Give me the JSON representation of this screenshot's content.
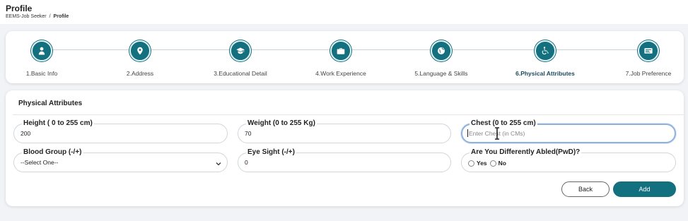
{
  "header": {
    "title": "Profile",
    "breadcrumb": [
      "EEMS-Job Seeker",
      "Profile"
    ],
    "separator": "/"
  },
  "stepper": {
    "steps": [
      {
        "label": "1.Basic Info",
        "icon": "user-icon",
        "active": false
      },
      {
        "label": "2.Address",
        "icon": "location-pin-icon",
        "active": false
      },
      {
        "label": "3.Educational Detail",
        "icon": "graduation-cap-icon",
        "active": false
      },
      {
        "label": "4.Work Experience",
        "icon": "briefcase-icon",
        "active": false
      },
      {
        "label": "5.Language & Skills",
        "icon": "globe-icon",
        "active": false
      },
      {
        "label": "6.Physical Attributes",
        "icon": "wheelchair-icon",
        "active": true
      },
      {
        "label": "7.Job Preference",
        "icon": "id-card-icon",
        "active": false
      }
    ]
  },
  "form": {
    "section_title": "Physical Attributes",
    "height": {
      "label": "Height ( 0 to 255 cm)",
      "value": "200"
    },
    "weight": {
      "label": "Weight (0 to 255 Kg)",
      "value": "70"
    },
    "chest": {
      "label": "Chest (0 to 255 cm)",
      "value": "",
      "placeholder": "Enter Chest (in CMs)"
    },
    "blood_group": {
      "label": "Blood Group (-/+)",
      "selected": "--Select One--"
    },
    "eye_sight": {
      "label": "Eye Sight (-/+)",
      "value": "0"
    },
    "pwd": {
      "label": "Are You Differently Abled(PwD)?",
      "options": [
        "Yes",
        "No"
      ]
    }
  },
  "actions": {
    "back_label": "Back",
    "add_label": "Add"
  },
  "colors": {
    "accent": "#12707f",
    "page_bg": "#f1f3f7"
  }
}
